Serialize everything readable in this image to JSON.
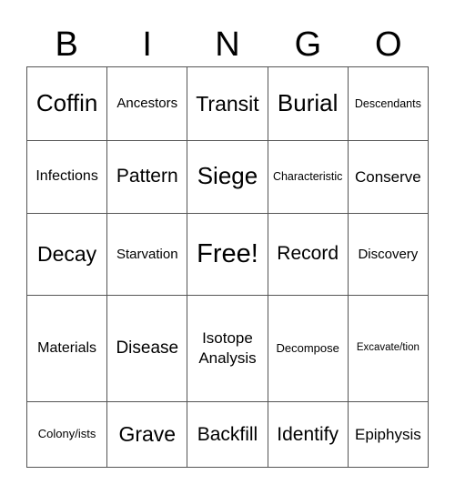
{
  "header": [
    "B",
    "I",
    "N",
    "G",
    "O"
  ],
  "rows": [
    [
      "Coffin",
      "Ancestors",
      "Transit",
      "Burial",
      "Descendants"
    ],
    [
      "Infections",
      "Pattern",
      "Siege",
      "Characteristic",
      "Conserve"
    ],
    [
      "Decay",
      "Starvation",
      "Free!",
      "Record",
      "Discovery"
    ],
    [
      "Materials",
      "Disease",
      "Isotope Analysis",
      "Decompose",
      "Excavate/tion"
    ],
    [
      "Colony/ists",
      "Grave",
      "Backfill",
      "Identify",
      "Epiphysis"
    ]
  ]
}
